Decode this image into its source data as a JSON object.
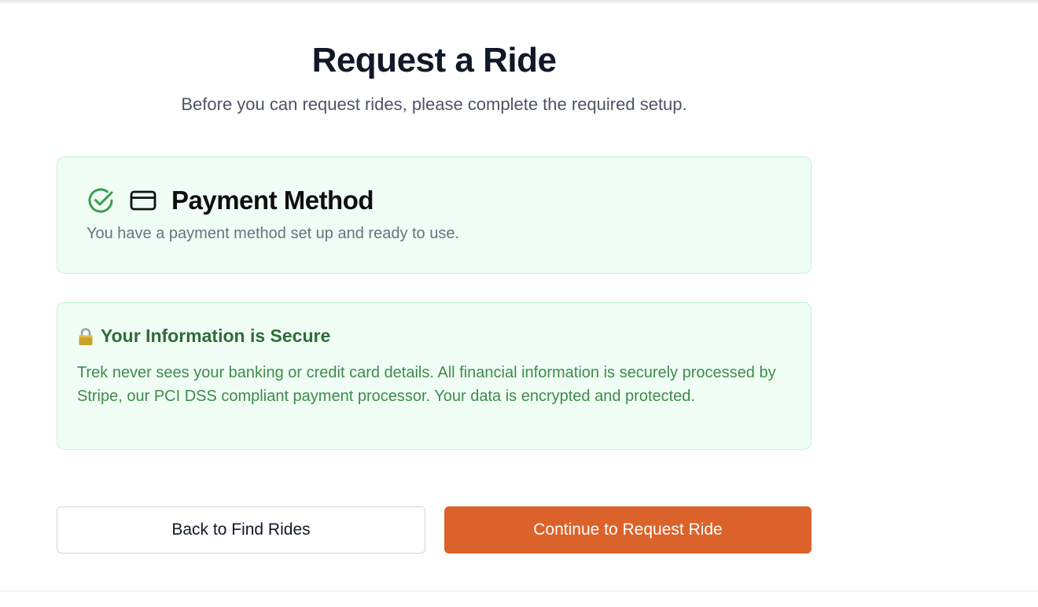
{
  "header": {
    "title": "Request a Ride",
    "subtitle": "Before you can request rides, please complete the required setup."
  },
  "payment_card": {
    "title": "Payment Method",
    "description": "You have a payment method set up and ready to use.",
    "status_icon": "check-circle-icon",
    "icon": "credit-card-icon",
    "status_color": "#3a9e4f"
  },
  "security_card": {
    "icon": "lock-icon",
    "title": "Your Information is Secure",
    "text": "Trek never sees your banking or credit card details. All financial information is securely processed by Stripe, our PCI DSS compliant payment processor. Your data is encrypted and protected."
  },
  "actions": {
    "back_label": "Back to Find Rides",
    "continue_label": "Continue to Request Ride",
    "accent_color": "#db622b"
  }
}
